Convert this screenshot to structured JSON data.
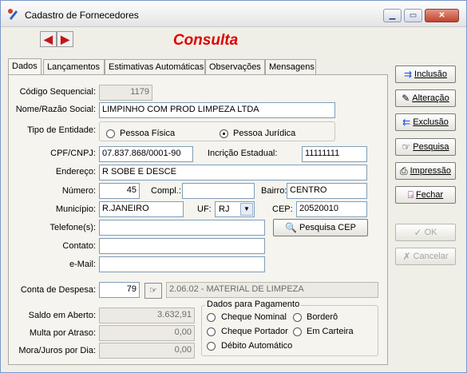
{
  "window": {
    "title": "Cadastro de Fornecedores",
    "minimize_label": "▁",
    "maximize_label": "▭",
    "close_label": "✕"
  },
  "nav": {
    "prev_glyph": "◀",
    "next_glyph": "▶"
  },
  "mode_title": "Consulta",
  "tabs": [
    "Dados",
    "Lançamentos",
    "Estimativas Automáticas",
    "Observações",
    "Mensagens"
  ],
  "form": {
    "codigo_label": "Código Sequencial:",
    "codigo": "1179",
    "nome_label": "Nome/Razão Social:",
    "nome": "LIMPINHO COM PROD LIMPEZA LTDA",
    "tipo_label": "Tipo de Entidade:",
    "pf_label": "Pessoa Física",
    "pj_label": "Pessoa Jurídica",
    "cpf_label": "CPF/CNPJ:",
    "cpf": "07.837.868/0001-90",
    "ie_label": "Incrição Estadual:",
    "ie": "11111111",
    "endereco_label": "Endereço:",
    "endereco": "R SOBE E DESCE",
    "numero_label": "Número:",
    "numero": "45",
    "compl_label": "Compl.:",
    "compl": "",
    "bairro_label": "Bairro:",
    "bairro": "CENTRO",
    "municipio_label": "Município:",
    "municipio": "R.JANEIRO",
    "uf_label": "UF:",
    "uf": "RJ",
    "cep_label": "CEP:",
    "cep": "20520010",
    "telefone_label": "Telefone(s):",
    "telefone": "",
    "contato_label": "Contato:",
    "contato": "",
    "email_label": "e-Mail:",
    "email": "",
    "pesquisa_cep_label": "Pesquisa CEP",
    "conta_label": "Conta de Despesa:",
    "conta": "79",
    "conta_desc": "2.06.02 - MATERIAL DE LIMPEZA",
    "saldo_label": "Saldo em Aberto:",
    "saldo": "3.632,91",
    "multa_label": "Multa por Atraso:",
    "multa": "0,00",
    "mora_label": "Mora/Juros por Dia:",
    "mora": "0,00",
    "pagamento_title": "Dados para Pagamento",
    "pag_cheque_nominal": "Cheque Nominal",
    "pag_bordero": "Borderô",
    "pag_cheque_portador": "Cheque Portador",
    "pag_em_carteira": "Em Carteira",
    "pag_debito": "Débito Automático"
  },
  "actions": {
    "inclusao": "Inclusão",
    "alteracao": "Alteração",
    "exclusao": "Exclusão",
    "pesquisa": "Pesquisa",
    "impressao": "Impressão",
    "fechar": "Fechar",
    "ok": "OK",
    "cancelar": "Cancelar"
  }
}
